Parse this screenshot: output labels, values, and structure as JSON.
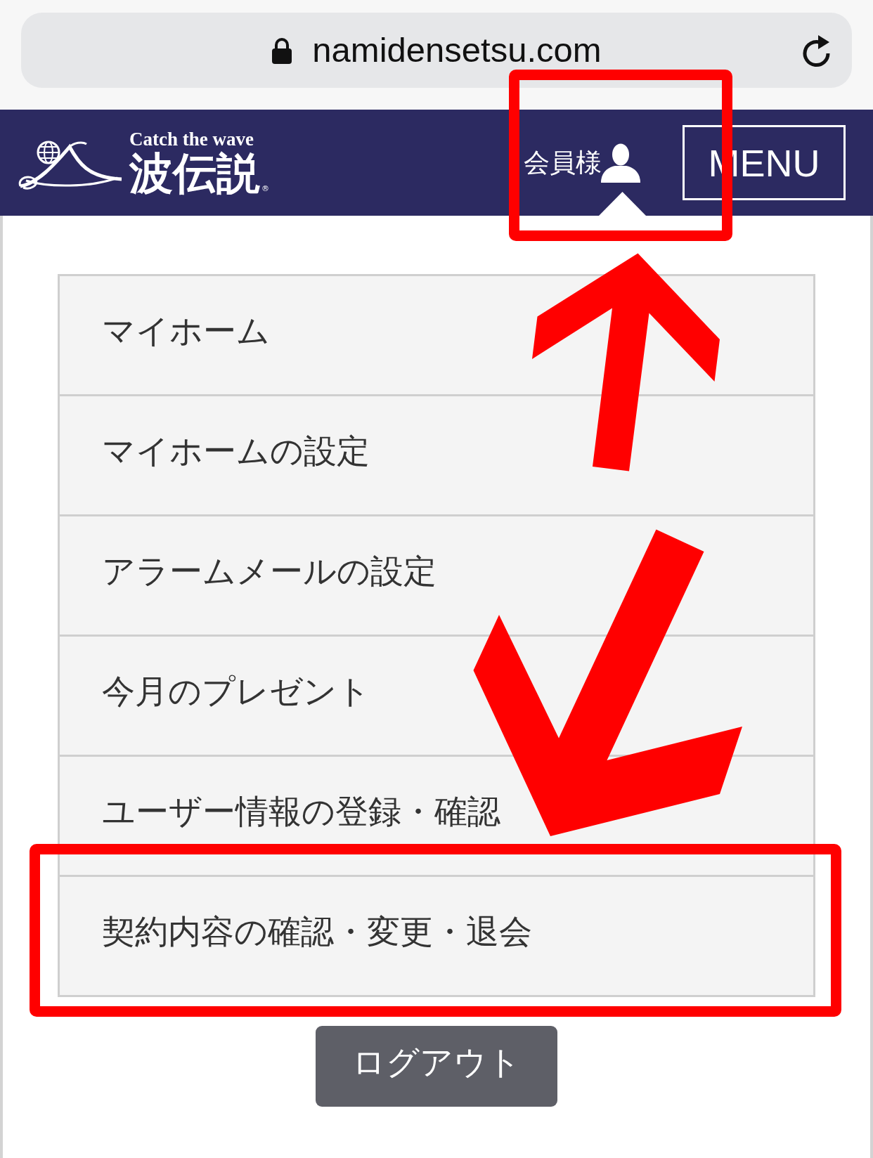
{
  "browser": {
    "url": "namidensetsu.com"
  },
  "header": {
    "logo": {
      "tagline": "Catch the wave",
      "name": "波伝説",
      "mark": "®"
    },
    "member_menu": {
      "label": "会員様",
      "expanded": true,
      "highlighted": true
    },
    "menu_button": {
      "label": "MENU"
    }
  },
  "menu_items": [
    {
      "label": "マイホーム",
      "highlighted": false
    },
    {
      "label": "マイホームの設定",
      "highlighted": false
    },
    {
      "label": "アラームメールの設定",
      "highlighted": false
    },
    {
      "label": "今月のプレゼント",
      "highlighted": false
    },
    {
      "label": "ユーザー情報の登録・確認",
      "highlighted": false
    },
    {
      "label": "契約内容の確認・変更・退会",
      "highlighted": true
    }
  ],
  "logout_button": {
    "label": "ログアウト"
  }
}
